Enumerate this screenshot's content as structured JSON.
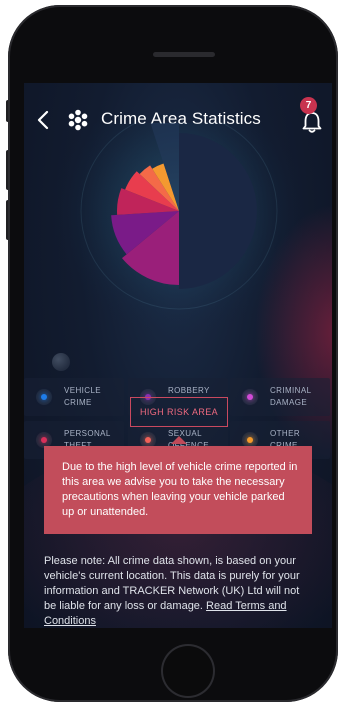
{
  "header": {
    "title": "Crime Area Statistics",
    "notification_count": "7"
  },
  "chart_data": {
    "type": "pie",
    "values": [
      50,
      14,
      10,
      7,
      6,
      4,
      4,
      5
    ],
    "colors": [
      "#1a2744",
      "#9a1f7a",
      "#7a1b88",
      "#c0245a",
      "#e83d4e",
      "#f46a48",
      "#f49930",
      "#243a5c"
    ]
  },
  "legend": [
    {
      "label": "VEHICLE CRIME",
      "color": "#1e7ce8"
    },
    {
      "label": "ROBBERY",
      "color": "#8a2fb0"
    },
    {
      "label": "CRIMINAL DAMAGE",
      "color": "#d04bd6"
    },
    {
      "label": "PERSONAL THEFT",
      "color": "#d8305a"
    },
    {
      "label": "SEXUAL OFFENCE",
      "color": "#f06158"
    },
    {
      "label": "OTHER CRIME",
      "color": "#f39a2c"
    }
  ],
  "risk_button": "HIGH RISK AREA",
  "alert_text": "Due to the high level of vehicle crime reported in this area we advise you to take the necessary precautions when leaving your vehicle parked up or unattended.",
  "note": {
    "text": "Please note: All crime data shown, is based on your vehicle's current location. This data is purely for your information and TRACKER Network (UK) Ltd will not be liable for any loss or damage.",
    "link": "Read Terms and Conditions"
  }
}
